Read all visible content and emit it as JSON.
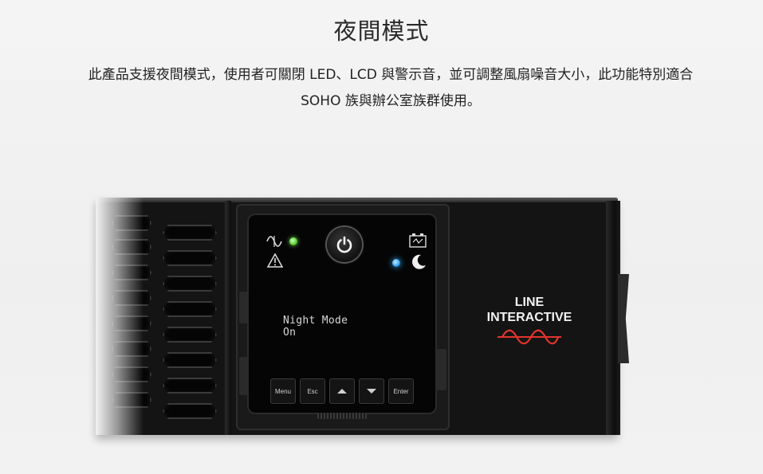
{
  "page": {
    "title": "夜間模式",
    "description": "此產品支援夜間模式，使用者可關閉 LED、LCD 與警示音，並可調整風扇噪音大小，此功能特別適合 SOHO 族與辦公室族群使用。"
  },
  "device": {
    "lcd": {
      "line1": "Night Mode",
      "line2": "On"
    },
    "buttons": [
      "Menu",
      "Esc",
      "up-arrow-icon",
      "down-arrow-icon",
      "Enter"
    ],
    "button_labels": {
      "menu": "Menu",
      "esc": "Esc",
      "enter": "Enter"
    },
    "brand": {
      "line1": "LINE",
      "line2": "INTERACTIVE"
    },
    "indicators": {
      "line_status_led": "#5bcc38",
      "night_mode_led": "#2ea0f0"
    },
    "icons": [
      "sine-wave-icon",
      "warning-icon",
      "power-icon",
      "battery-icon",
      "moon-icon",
      "line-interactive-wave-icon"
    ],
    "accent_color": "#e2342c"
  }
}
